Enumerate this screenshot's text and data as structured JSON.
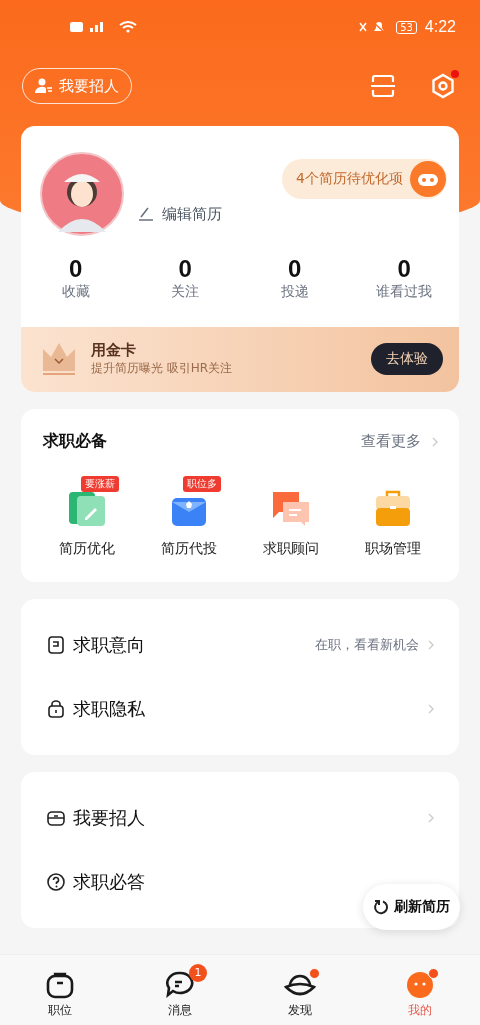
{
  "status_bar": {
    "time": "4:22",
    "battery": "53"
  },
  "header": {
    "recruit_button": "我要招人",
    "settings_dot": true
  },
  "profile": {
    "edit_label": "编辑简历",
    "optimize_tip": "4个简历待优化项",
    "stats": [
      {
        "value": "0",
        "label": "收藏"
      },
      {
        "value": "0",
        "label": "关注"
      },
      {
        "value": "0",
        "label": "投递"
      },
      {
        "value": "0",
        "label": "谁看过我"
      }
    ]
  },
  "gold_card": {
    "title": "用金卡",
    "subtitle": "提升简历曝光 吸引HR关注",
    "button": "去体验"
  },
  "tools": {
    "title": "求职必备",
    "more": "查看更多",
    "items": [
      {
        "kind": "resume",
        "label": "简历优化",
        "tag": "要涨薪"
      },
      {
        "kind": "deliver",
        "label": "简历代投",
        "tag": "职位多"
      },
      {
        "kind": "advisor",
        "label": "求职顾问"
      },
      {
        "kind": "career",
        "label": "职场管理"
      }
    ]
  },
  "menu_groups": [
    [
      {
        "kind": "intent",
        "label": "求职意向",
        "value": "在职，看看新机会",
        "chevron": true
      },
      {
        "kind": "privacy",
        "label": "求职隐私",
        "chevron": true
      }
    ],
    [
      {
        "kind": "recruit",
        "label": "我要招人",
        "chevron": true
      },
      {
        "kind": "faq",
        "label": "求职必答",
        "chevron": false
      }
    ]
  ],
  "refresh_button": "刷新简历",
  "tabs": [
    {
      "kind": "jobs",
      "label": "职位",
      "selected": false
    },
    {
      "kind": "messages",
      "label": "消息",
      "selected": false,
      "badge": "1"
    },
    {
      "kind": "discover",
      "label": "发现",
      "selected": false,
      "dot": true
    },
    {
      "kind": "mine",
      "label": "我的",
      "selected": true,
      "dot": true
    }
  ]
}
